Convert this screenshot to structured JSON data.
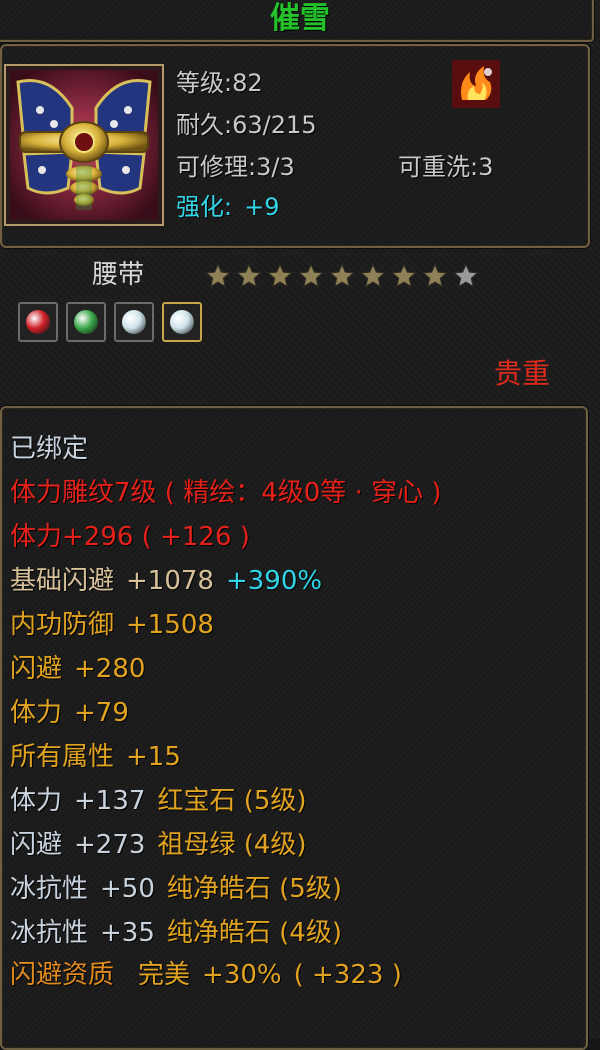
{
  "item": {
    "name": "催雪",
    "level_text": "等级:82",
    "durability_text": "耐久:63/215",
    "repair_text": "可修理:3/3",
    "rewash_text": "可重洗:3",
    "enhance_text": "强化:",
    "enhance_value": "+9",
    "type_label": "腰带",
    "stars_total": 9,
    "stars_filled": 8,
    "rarity": "贵重"
  },
  "gem_slots": [
    {
      "name": "ruby-gem-icon",
      "color": "#d0222a",
      "selected": false
    },
    {
      "name": "emerald-gem-icon",
      "color": "#3aa84a",
      "selected": false
    },
    {
      "name": "diamond-gem-icon",
      "color": "#cfe3ea",
      "selected": false
    },
    {
      "name": "diamond-gem-icon",
      "color": "#cfe3ea",
      "selected": true
    }
  ],
  "stats": {
    "bound": "已绑定",
    "carving": "体力雕纹7级 ( 精绘：4级0等 · 穿心 )",
    "stamina_line": "体力+296 ( +126 )",
    "base_dodge_label": "基础闪避",
    "base_dodge_value": "+1078",
    "base_dodge_bonus": "+390%",
    "inner_def_label": "内功防御",
    "inner_def_value": "+1508",
    "dodge_label": "闪避",
    "dodge_value": "+280",
    "stamina_label": "体力",
    "stamina_value": "+79",
    "all_attr_label": "所有属性",
    "all_attr_value": "+15",
    "gem1_attr": "体力",
    "gem1_value": "+137",
    "gem1_name": "红宝石 (5级)",
    "gem2_attr": "闪避",
    "gem2_value": "+273",
    "gem2_name": "祖母绿 (4级)",
    "gem3_attr": "冰抗性",
    "gem3_value": "+50",
    "gem3_name": "纯净皓石 (5级)",
    "gem4_attr": "冰抗性",
    "gem4_value": "+35",
    "gem4_name": "纯净皓石 (4级)",
    "quality_label": "闪避资质",
    "quality_grade": "完美",
    "quality_pct": "+30%",
    "quality_value": "( +323 )"
  },
  "colors": {
    "name": "#23c12a",
    "enhance": "#33d6e6",
    "red": "#e4221a",
    "gold": "#e1a320",
    "orange": "#e08a1e"
  }
}
